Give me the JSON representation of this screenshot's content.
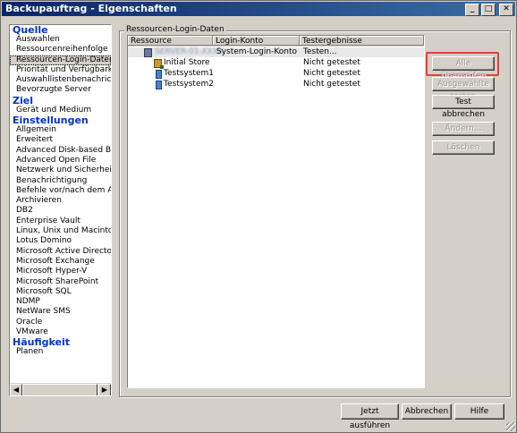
{
  "window": {
    "title": "Backupauftrag - Eigenschaften",
    "buttons": [
      "_",
      "□",
      "✕"
    ]
  },
  "sidebar": {
    "sections": [
      {
        "label": "Quelle",
        "items": [
          "Auswahlen",
          "Ressourcenreihenfolge",
          "Ressourcen-Login-Daten",
          "Priorität und Verfügbarkeit",
          "Auswahllistenbenachrichtigung",
          "Bevorzugte Server"
        ]
      },
      {
        "label": "Ziel",
        "items": [
          "Gerät und Medium"
        ]
      },
      {
        "label": "Einstellungen",
        "items": [
          "Allgemein",
          "Erweitert",
          "Advanced Disk-based Backup",
          "Advanced Open File",
          "Netzwerk und Sicherheit",
          "Benachrichtigung",
          "Befehle vor/nach dem Auftrag",
          "Archivieren",
          "DB2",
          "Enterprise Vault",
          "Linux, Unix und Macintosh",
          "Lotus Domino",
          "Microsoft Active Directory",
          "Microsoft Exchange",
          "Microsoft Hyper-V",
          "Microsoft SharePoint",
          "Microsoft SQL",
          "NDMP",
          "NetWare SMS",
          "Oracle",
          "VMware"
        ]
      },
      {
        "label": "Häufigkeit",
        "items": [
          "Planen"
        ]
      }
    ],
    "selected": "Ressourcen-Login-Daten"
  },
  "group_title": "Ressourcen-Login-Daten",
  "table": {
    "columns": [
      "Ressource",
      "Login-Konto",
      "Testergebnisse"
    ],
    "rows": [
      {
        "resource": "SERVER-01-XXXX",
        "account": "System-Login-Konto",
        "result": "Testen...",
        "icon": "server-icon"
      },
      {
        "resource": "Initial Store",
        "account": "",
        "result": "Nicht getestet",
        "icon": "store-icon"
      },
      {
        "resource": "Testsystem1",
        "account": "",
        "result": "Nicht getestet",
        "icon": "system-icon"
      },
      {
        "resource": "Testsystem2",
        "account": "",
        "result": "Nicht getestet",
        "icon": "system-icon"
      }
    ]
  },
  "buttons": {
    "check_all": "Alle überprüfen",
    "check_selected": "Ausgewählte testen",
    "cancel_test": "Test abbrechen",
    "change": "Ändern...",
    "delete": "Löschen",
    "run_now": "Jetzt ausführen",
    "cancel": "Abbrechen",
    "help": "Hilfe"
  },
  "colors": {
    "highlight_frame": "#e24040",
    "category_text": "#0033cc",
    "title_bar": "#0a246a"
  }
}
